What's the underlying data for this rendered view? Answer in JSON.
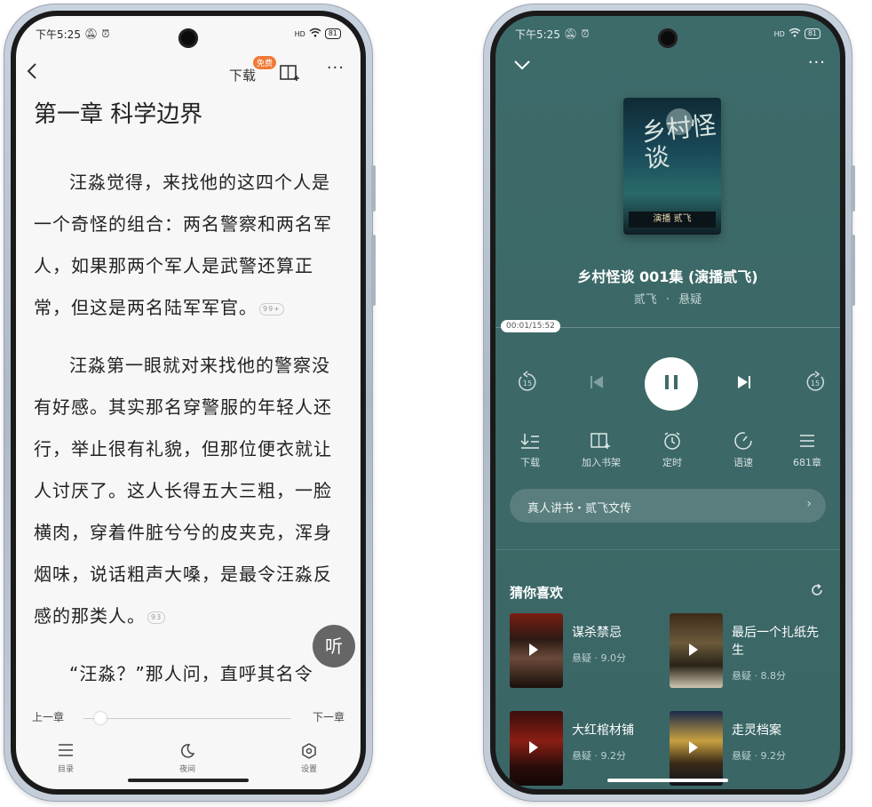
{
  "status_bar": {
    "time": "下午5:25",
    "signal": "HD",
    "battery": "81"
  },
  "reader": {
    "download_label": "下载",
    "free_badge": "免费",
    "chapter_title": "第一章 科学边界",
    "paragraphs": [
      {
        "text": "汪淼觉得，来找他的这四个人是一个奇怪的组合：两名警察和两名军人，如果那两个军人是武警还算正常，但这是两名陆军军官。",
        "comments": "99+"
      },
      {
        "text": "汪淼第一眼就对来找他的警察没有好感。其实那名穿警服的年轻人还行，举止很有礼貌，但那位便衣就让人讨厌了。这人长得五大三粗，一脸横肉，穿着件脏兮兮的皮夹克，浑身烟味，说话粗声大嗓，是最令汪淼反感的那类人。",
        "comments": "93"
      },
      {
        "text": "“汪淼？”那人问，直呼其名令",
        "comments": ""
      }
    ],
    "listen_label": "听",
    "prev_chapter": "上一章",
    "next_chapter": "下一章",
    "progress": 0.06,
    "bottom_nav": [
      {
        "icon": "list-icon",
        "label": "目录"
      },
      {
        "icon": "moon-icon",
        "label": "夜间"
      },
      {
        "icon": "settings-icon",
        "label": "设置"
      }
    ]
  },
  "player": {
    "cover_title": "乡村怪谈",
    "cover_caption": "演播 贰飞",
    "track_title": "乡村怪谈 001集 (演播贰飞)",
    "author": "贰飞",
    "separator": "·",
    "genre": "悬疑",
    "time_display": "00:01/15:52",
    "progress": 0.001,
    "rewind_label": "15",
    "forward_label": "15",
    "actions": [
      {
        "icon": "download-icon",
        "label": "下载"
      },
      {
        "icon": "add-bookshelf-icon",
        "label": "加入书架"
      },
      {
        "icon": "alarm-icon",
        "label": "定时"
      },
      {
        "icon": "speed-icon",
        "label": "语速"
      },
      {
        "icon": "list-icon",
        "label": "681章"
      }
    ],
    "banner": "真人讲书・贰飞文传",
    "recommend_title": "猜你喜欢",
    "recommendations": [
      {
        "name": "谋杀禁忌",
        "genre": "悬疑",
        "score": "9.0分"
      },
      {
        "name": "最后一个扎纸先生",
        "genre": "悬疑",
        "score": "8.8分"
      },
      {
        "name": "大红棺材铺",
        "genre": "悬疑",
        "score": "9.2分"
      },
      {
        "name": "走灵档案",
        "genre": "悬疑",
        "score": "9.2分"
      }
    ]
  },
  "colors": {
    "player_bg": "#3d6b6a",
    "reader_bg": "#f7f7f7",
    "free_badge": "#f07a36"
  }
}
